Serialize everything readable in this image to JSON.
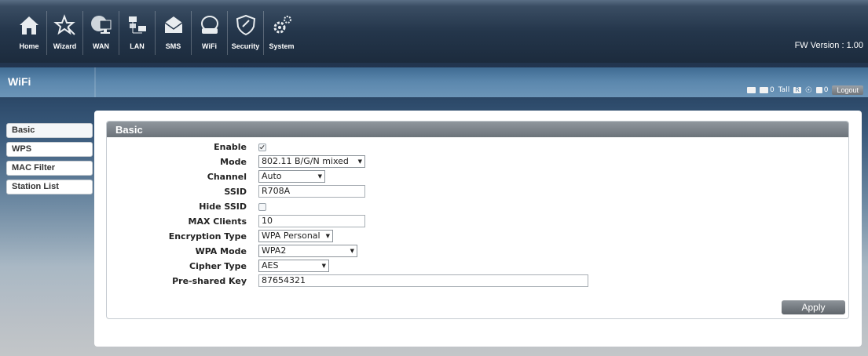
{
  "nav": {
    "items": [
      {
        "label": "Home",
        "icon": "home-icon"
      },
      {
        "label": "Wizard",
        "icon": "wizard-icon"
      },
      {
        "label": "WAN",
        "icon": "wan-icon"
      },
      {
        "label": "LAN",
        "icon": "lan-icon"
      },
      {
        "label": "SMS",
        "icon": "sms-icon"
      },
      {
        "label": "WiFi",
        "icon": "wifi-icon"
      },
      {
        "label": "Security",
        "icon": "security-icon"
      },
      {
        "label": "System",
        "icon": "system-icon"
      }
    ]
  },
  "fw_version": "FW Version : 1.00",
  "page_title": "WiFi",
  "status": {
    "sms_count": "0",
    "signal": "Tall",
    "r_badge": "R",
    "msg_count": "0",
    "logout_label": "Logout"
  },
  "sidebar": {
    "items": [
      {
        "label": "Basic"
      },
      {
        "label": "WPS"
      },
      {
        "label": "MAC Filter"
      },
      {
        "label": "Station List"
      }
    ]
  },
  "section_title": "Basic",
  "form": {
    "enable": {
      "label": "Enable",
      "checked": true
    },
    "mode": {
      "label": "Mode",
      "value": "802.11 B/G/N mixed"
    },
    "channel": {
      "label": "Channel",
      "value": "Auto"
    },
    "ssid": {
      "label": "SSID",
      "value": "R708A"
    },
    "hide_ssid": {
      "label": "Hide SSID",
      "checked": false
    },
    "max_clients": {
      "label": "MAX Clients",
      "value": "10"
    },
    "encryption_type": {
      "label": "Encryption Type",
      "value": "WPA Personal"
    },
    "wpa_mode": {
      "label": "WPA Mode",
      "value": "WPA2"
    },
    "cipher_type": {
      "label": "Cipher Type",
      "value": "AES"
    },
    "psk": {
      "label": "Pre-shared Key",
      "value": "87654321"
    }
  },
  "apply_label": "Apply",
  "colors": {
    "topbar": "#1c2b3d",
    "subbar": "#5b87ad",
    "section_header": "#7a8188"
  }
}
